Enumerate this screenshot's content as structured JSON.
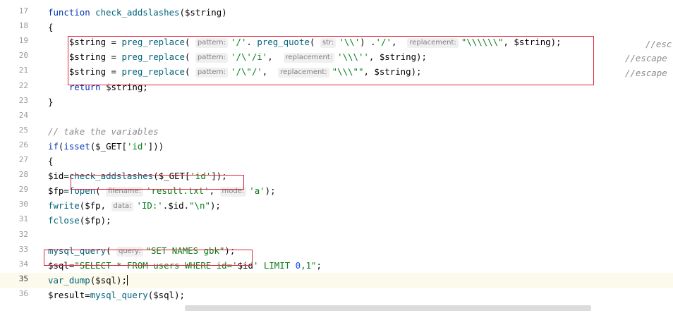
{
  "lines": [
    {
      "num": "17",
      "segments": [
        {
          "cls": "kw",
          "t": "function "
        },
        {
          "cls": "fn",
          "t": "check_addslashes"
        },
        {
          "cls": "",
          "t": "("
        },
        {
          "cls": "var",
          "t": "$string"
        },
        {
          "cls": "",
          "t": ")"
        }
      ]
    },
    {
      "num": "18",
      "segments": [
        {
          "cls": "",
          "t": "{"
        }
      ]
    },
    {
      "num": "19",
      "segments": [
        {
          "cls": "var",
          "t": "    $string"
        },
        {
          "cls": "",
          "t": " = "
        },
        {
          "cls": "fn",
          "t": "preg_replace"
        },
        {
          "cls": "",
          "t": "( "
        },
        {
          "cls": "hint",
          "t": "pattern:"
        },
        {
          "cls": "str",
          "t": "'/'"
        },
        {
          "cls": "",
          "t": ". "
        },
        {
          "cls": "fn",
          "t": "preg_quote"
        },
        {
          "cls": "",
          "t": "( "
        },
        {
          "cls": "hint",
          "t": "str:"
        },
        {
          "cls": "str",
          "t": "'\\\\'"
        },
        {
          "cls": "",
          "t": ") ."
        },
        {
          "cls": "str",
          "t": "'/'"
        },
        {
          "cls": "",
          "t": ",  "
        },
        {
          "cls": "hint",
          "t": "replacement:"
        },
        {
          "cls": "str",
          "t": "\"\\\\\\\\\\\\\""
        },
        {
          "cls": "",
          "t": ", "
        },
        {
          "cls": "var",
          "t": "$string"
        },
        {
          "cls": "",
          "t": ");"
        }
      ]
    },
    {
      "num": "20",
      "segments": [
        {
          "cls": "var",
          "t": "    $string"
        },
        {
          "cls": "",
          "t": " = "
        },
        {
          "cls": "fn",
          "t": "preg_replace"
        },
        {
          "cls": "",
          "t": "( "
        },
        {
          "cls": "hint",
          "t": "pattern:"
        },
        {
          "cls": "str",
          "t": "'/\\'/i'"
        },
        {
          "cls": "",
          "t": ",  "
        },
        {
          "cls": "hint",
          "t": "replacement:"
        },
        {
          "cls": "str",
          "t": "'\\\\\\''"
        },
        {
          "cls": "",
          "t": ", "
        },
        {
          "cls": "var",
          "t": "$string"
        },
        {
          "cls": "",
          "t": ");"
        }
      ]
    },
    {
      "num": "21",
      "segments": [
        {
          "cls": "var",
          "t": "    $string"
        },
        {
          "cls": "",
          "t": " = "
        },
        {
          "cls": "fn",
          "t": "preg_replace"
        },
        {
          "cls": "",
          "t": "( "
        },
        {
          "cls": "hint",
          "t": "pattern:"
        },
        {
          "cls": "str",
          "t": "'/\\\"/'"
        },
        {
          "cls": "",
          "t": ",  "
        },
        {
          "cls": "hint",
          "t": "replacement:"
        },
        {
          "cls": "str",
          "t": "\"\\\\\\\"\""
        },
        {
          "cls": "",
          "t": ", "
        },
        {
          "cls": "var",
          "t": "$string"
        },
        {
          "cls": "",
          "t": ");"
        }
      ]
    },
    {
      "num": "22",
      "segments": [
        {
          "cls": "kw",
          "t": "    return "
        },
        {
          "cls": "var",
          "t": "$string"
        },
        {
          "cls": "",
          "t": ";"
        }
      ]
    },
    {
      "num": "23",
      "segments": [
        {
          "cls": "",
          "t": "}"
        }
      ]
    },
    {
      "num": "24",
      "segments": []
    },
    {
      "num": "25",
      "segments": [
        {
          "cls": "cm",
          "t": "// take the variables"
        }
      ]
    },
    {
      "num": "26",
      "segments": [
        {
          "cls": "kw",
          "t": "if"
        },
        {
          "cls": "",
          "t": "("
        },
        {
          "cls": "kw",
          "t": "isset"
        },
        {
          "cls": "",
          "t": "("
        },
        {
          "cls": "var",
          "t": "$_GET"
        },
        {
          "cls": "",
          "t": "["
        },
        {
          "cls": "str",
          "t": "'id'"
        },
        {
          "cls": "",
          "t": "]))"
        }
      ]
    },
    {
      "num": "27",
      "segments": [
        {
          "cls": "",
          "t": "{"
        }
      ]
    },
    {
      "num": "28",
      "segments": [
        {
          "cls": "var",
          "t": "$id"
        },
        {
          "cls": "",
          "t": "="
        },
        {
          "cls": "fn",
          "t": "check_addslashes"
        },
        {
          "cls": "",
          "t": "("
        },
        {
          "cls": "var",
          "t": "$_GET"
        },
        {
          "cls": "",
          "t": "["
        },
        {
          "cls": "str",
          "t": "'id'"
        },
        {
          "cls": "",
          "t": "]);"
        }
      ]
    },
    {
      "num": "29",
      "segments": [
        {
          "cls": "var",
          "t": "$fp"
        },
        {
          "cls": "",
          "t": "="
        },
        {
          "cls": "fn",
          "t": "fopen"
        },
        {
          "cls": "",
          "t": "( "
        },
        {
          "cls": "hint",
          "t": "filename:"
        },
        {
          "cls": "str",
          "t": "'result.txt'"
        },
        {
          "cls": "",
          "t": ", "
        },
        {
          "cls": "hint",
          "t": "mode:"
        },
        {
          "cls": "str",
          "t": "'a'"
        },
        {
          "cls": "",
          "t": ");"
        }
      ]
    },
    {
      "num": "30",
      "segments": [
        {
          "cls": "fn",
          "t": "fwrite"
        },
        {
          "cls": "",
          "t": "("
        },
        {
          "cls": "var",
          "t": "$fp"
        },
        {
          "cls": "",
          "t": ", "
        },
        {
          "cls": "hint",
          "t": "data:"
        },
        {
          "cls": "str",
          "t": "'ID:'"
        },
        {
          "cls": "",
          "t": "."
        },
        {
          "cls": "var",
          "t": "$id"
        },
        {
          "cls": "",
          "t": "."
        },
        {
          "cls": "str",
          "t": "\"\\n\""
        },
        {
          "cls": "",
          "t": ");"
        }
      ]
    },
    {
      "num": "31",
      "segments": [
        {
          "cls": "fn",
          "t": "fclose"
        },
        {
          "cls": "",
          "t": "("
        },
        {
          "cls": "var",
          "t": "$fp"
        },
        {
          "cls": "",
          "t": ");"
        }
      ]
    },
    {
      "num": "32",
      "segments": []
    },
    {
      "num": "33",
      "segments": [
        {
          "cls": "fn",
          "t": "mysql_query"
        },
        {
          "cls": "",
          "t": "( "
        },
        {
          "cls": "hint",
          "t": "query:"
        },
        {
          "cls": "str",
          "t": "\"SET NAMES gbk\""
        },
        {
          "cls": "",
          "t": ");"
        }
      ]
    },
    {
      "num": "34",
      "segments": [
        {
          "cls": "var",
          "t": "$sql"
        },
        {
          "cls": "",
          "t": "="
        },
        {
          "cls": "str",
          "t": "\"SELECT * FROM users WHERE id='"
        },
        {
          "cls": "var",
          "t": "$id"
        },
        {
          "cls": "str",
          "t": "' LIMIT "
        },
        {
          "cls": "num",
          "t": "0"
        },
        {
          "cls": "str",
          "t": ",1\""
        },
        {
          "cls": "",
          "t": ";"
        }
      ]
    },
    {
      "num": "35",
      "current": true,
      "segments": [
        {
          "cls": "fn",
          "t": "var_dump"
        },
        {
          "cls": "",
          "t": "("
        },
        {
          "cls": "var",
          "t": "$sql"
        },
        {
          "cls": "",
          "t": ");"
        }
      ]
    },
    {
      "num": "36",
      "segments": [
        {
          "cls": "var",
          "t": "$result"
        },
        {
          "cls": "",
          "t": "="
        },
        {
          "cls": "fn",
          "t": "mysql_query"
        },
        {
          "cls": "",
          "t": "("
        },
        {
          "cls": "var",
          "t": "$sql"
        },
        {
          "cls": "",
          "t": ");"
        }
      ]
    }
  ],
  "comments": {
    "line19": "//esc",
    "line20": "//escape",
    "line21": "//escape"
  },
  "colors": {
    "highlight_box": "#e0233c",
    "current_line": "#fcfaed"
  }
}
